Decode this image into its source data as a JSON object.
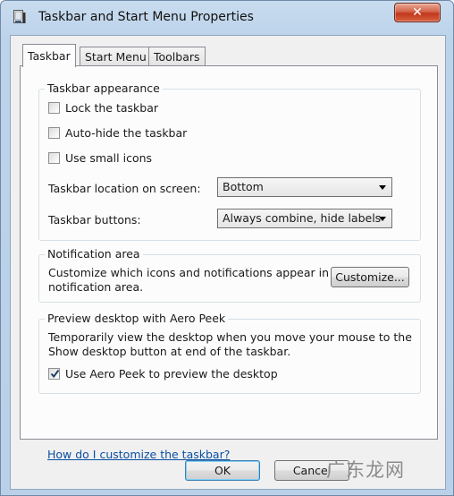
{
  "window": {
    "title": "Taskbar and Start Menu Properties",
    "close_symbol": "✕"
  },
  "tabs": [
    {
      "label": "Taskbar",
      "active": true
    },
    {
      "label": "Start Menu",
      "active": false
    },
    {
      "label": "Toolbars",
      "active": false
    }
  ],
  "appearance": {
    "legend": "Taskbar appearance",
    "lock_label": "Lock the taskbar",
    "lock_checked": false,
    "autohide_label": "Auto-hide the taskbar",
    "autohide_checked": false,
    "small_icons_label": "Use small icons",
    "small_icons_checked": false,
    "location_label": "Taskbar location on screen:",
    "location_value": "Bottom",
    "buttons_label": "Taskbar buttons:",
    "buttons_value": "Always combine, hide labels"
  },
  "notification": {
    "legend": "Notification area",
    "text_line1": "Customize which icons and notifications appear in the",
    "text_line2": "notification area.",
    "customize_label": "Customize..."
  },
  "aero_peek": {
    "legend": "Preview desktop with Aero Peek",
    "text_line1": "Temporarily view the desktop when you move your mouse to the",
    "text_line2": "Show desktop button at end of the taskbar.",
    "checkbox_label": "Use Aero Peek to preview the desktop",
    "checked": true
  },
  "help_link": "How do I customize the taskbar?",
  "footer": {
    "ok_label": "OK",
    "cancel_label": "Cancel"
  },
  "watermark": "广东龙网"
}
